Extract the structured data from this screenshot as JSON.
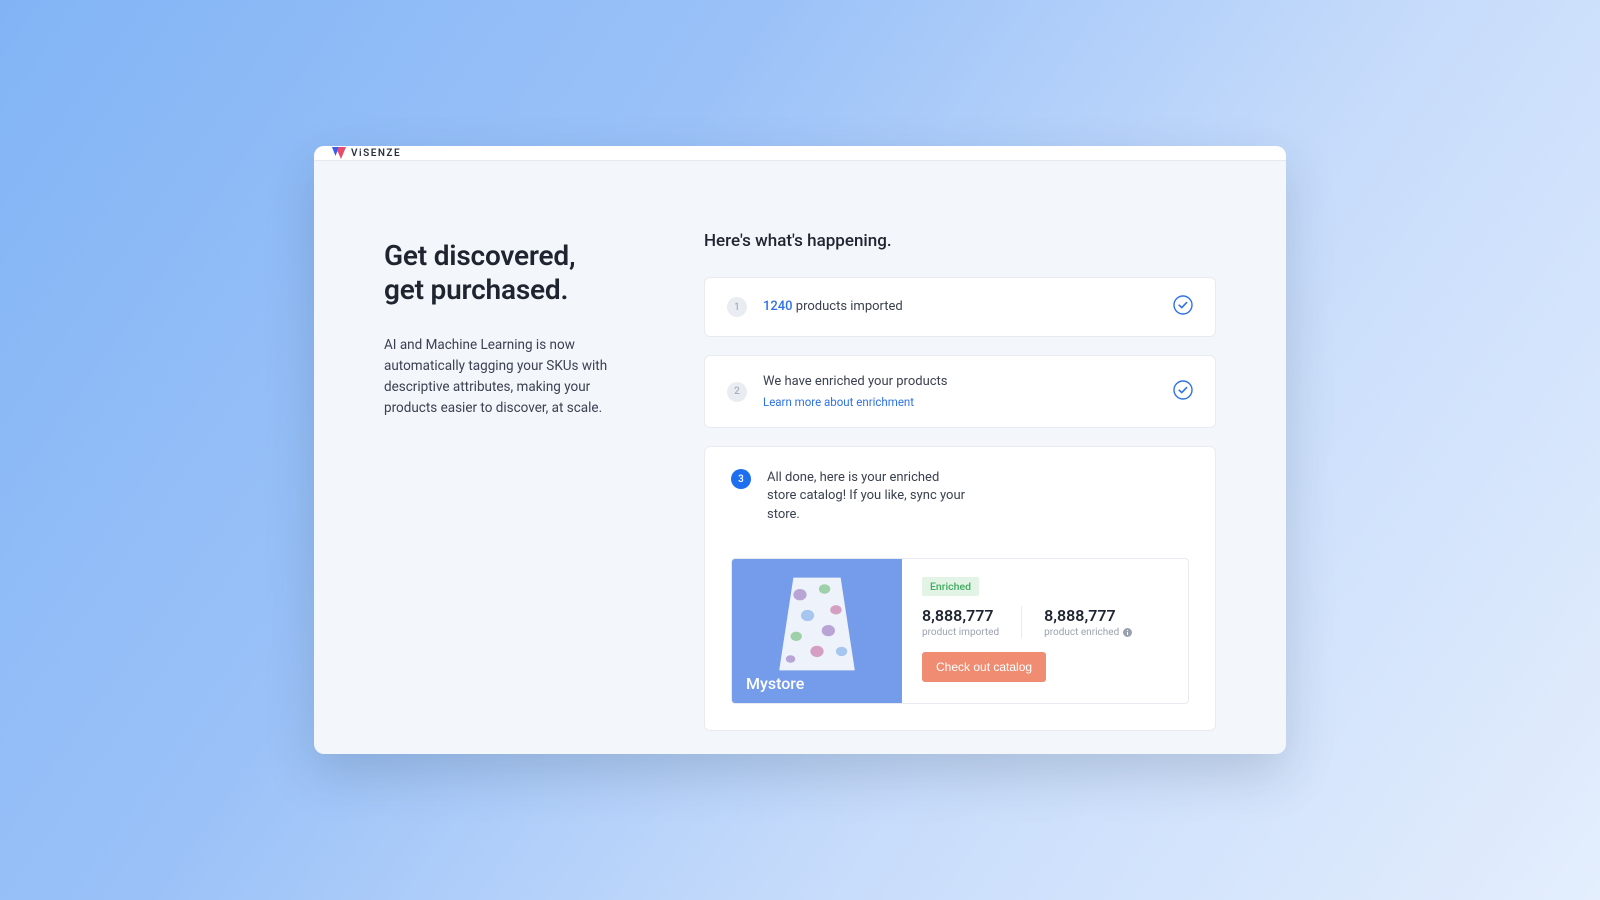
{
  "brand": {
    "name": "ViSENZE"
  },
  "hero": {
    "headline": "Get discovered,\nget purchased.",
    "subtext": "AI and Machine Learning is now automatically tagging your SKUs with descriptive attributes, making your products easier to discover, at scale."
  },
  "section_title": "Here's what's happening.",
  "steps": {
    "s1": {
      "num": "1",
      "count": "1240",
      "suffix": " products imported"
    },
    "s2": {
      "num": "2",
      "text": "We have enriched your products",
      "link": "Learn more about enrichment"
    },
    "s3": {
      "num": "3",
      "text": "All done, here is your enriched store catalog! If you like, sync your store."
    }
  },
  "store": {
    "name": "Mystore",
    "badge": "Enriched",
    "stats": {
      "imported": {
        "value": "8,888,777",
        "label": "product imported"
      },
      "enriched": {
        "value": "8,888,777",
        "label": "product enriched"
      }
    },
    "cta": "Check out catalog"
  },
  "colors": {
    "accent": "#1d6ff0",
    "cta": "#f08c72",
    "success": "#3fab5e"
  }
}
